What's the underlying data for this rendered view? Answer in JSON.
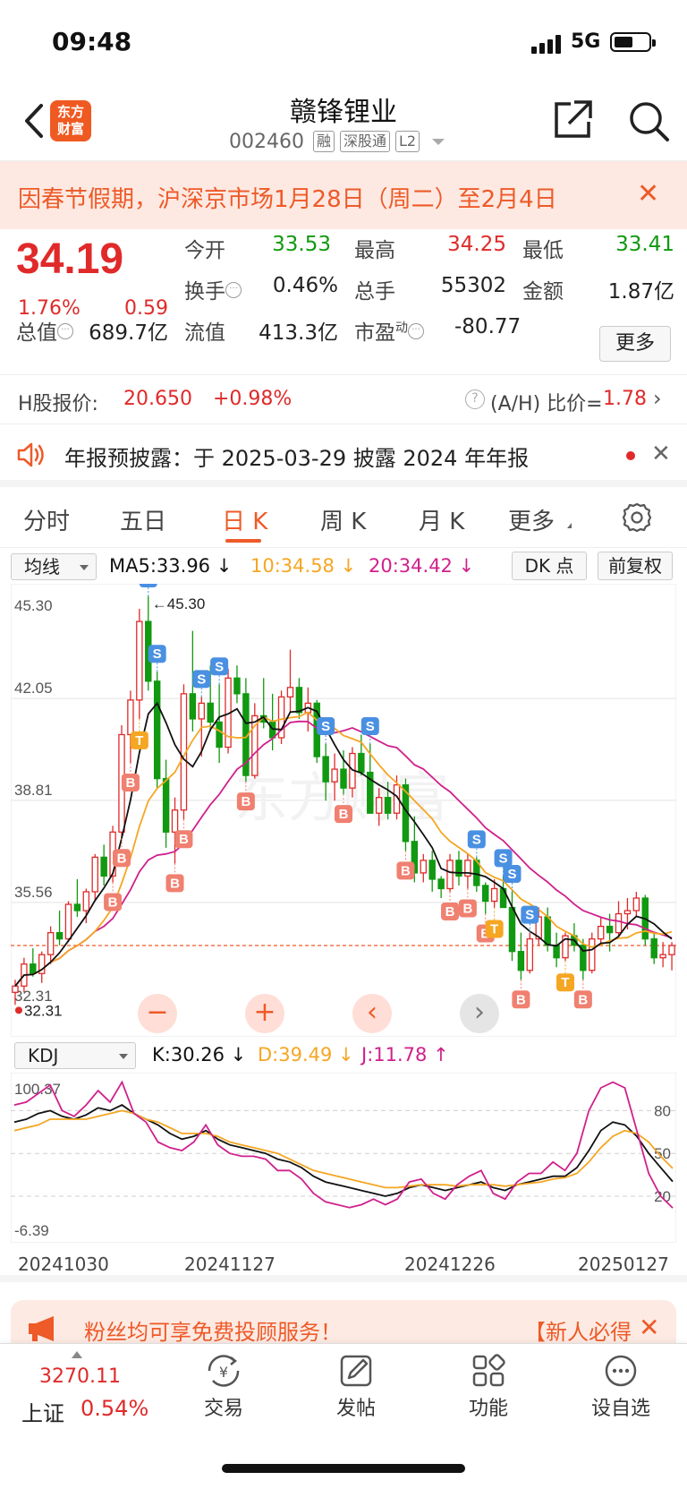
{
  "status_bar": {
    "time": "09:48",
    "network": "5G"
  },
  "header": {
    "back_icon": "chevron-left-icon",
    "logo_text_line1": "东方",
    "logo_text_line2": "财富",
    "title": "赣锋锂业",
    "code": "002460",
    "tags": [
      "融",
      "深股通",
      "L2"
    ],
    "share_icon": "share-icon",
    "search_icon": "search-icon"
  },
  "notice": {
    "text": "因春节假期，沪深京市场1月28日（周二）至2月4日",
    "close": "✕"
  },
  "quote": {
    "price": "34.19",
    "pct_change": "1.76%",
    "change": "0.59",
    "open_label": "今开",
    "open": "33.53",
    "high_label": "最高",
    "high": "34.25",
    "low_label": "最低",
    "low": "33.41",
    "turnover_label": "换手",
    "turnover": "0.46%",
    "volume_label": "总手",
    "volume": "55302",
    "amount_label": "金额",
    "amount": "1.87亿",
    "mktcap_label": "总值",
    "mktcap": "689.7亿",
    "float_label": "流值",
    "float": "413.3亿",
    "pe_label": "市盈",
    "pe_sup": "动",
    "pe": "-80.77",
    "more_label": "更多"
  },
  "h_share": {
    "label": "H股报价:",
    "price": "20.650",
    "change": "+0.98%",
    "ratio_label": "(A/H) 比价=",
    "ratio": "1.78"
  },
  "announcement": {
    "text": "年报预披露：于 2025-03-29 披露 2024 年年报",
    "close": "✕"
  },
  "tabs": [
    {
      "label": "分时"
    },
    {
      "label": "五日"
    },
    {
      "label": "日 K",
      "active": true
    },
    {
      "label": "周 K"
    },
    {
      "label": "月 K"
    },
    {
      "label": "更多"
    }
  ],
  "ma_bar": {
    "selector": "均线",
    "ma5": "MA5:33.96 ↓",
    "ma10": "10:34.58 ↓",
    "ma20": "20:34.42 ↓",
    "dk_label": "DK 点",
    "adjust_label": "前复权",
    "colors": {
      "ma5": "#111111",
      "ma10": "#f5a623",
      "ma20": "#d0208c",
      "up": "#e02a2a",
      "down": "#119911"
    }
  },
  "chart_data": [
    {
      "type": "candlestick",
      "y_ticks": [
        "45.30",
        "42.05",
        "38.81",
        "35.56",
        "32.31"
      ],
      "ylim": [
        32.31,
        45.3
      ],
      "high_marker": "←45.30",
      "low_marker": "32.31",
      "last_close": 34.19,
      "candles": [
        [
          32.7,
          33.1,
          32.3,
          32.9
        ],
        [
          32.9,
          33.8,
          32.7,
          33.6
        ],
        [
          33.6,
          34.1,
          33.2,
          33.3
        ],
        [
          33.3,
          34.0,
          33.0,
          33.9
        ],
        [
          33.9,
          34.8,
          33.6,
          34.6
        ],
        [
          34.6,
          35.3,
          34.2,
          34.4
        ],
        [
          34.4,
          35.6,
          34.3,
          35.5
        ],
        [
          35.5,
          36.3,
          35.1,
          35.3
        ],
        [
          35.3,
          36.0,
          34.9,
          35.9
        ],
        [
          35.9,
          37.1,
          35.6,
          37.0
        ],
        [
          37.0,
          37.4,
          36.1,
          36.4
        ],
        [
          36.4,
          38.0,
          36.2,
          37.8
        ],
        [
          37.8,
          41.2,
          37.6,
          40.9
        ],
        [
          40.9,
          42.3,
          40.0,
          42.0
        ],
        [
          42.0,
          44.9,
          41.4,
          44.5
        ],
        [
          44.5,
          45.3,
          42.3,
          42.6
        ],
        [
          42.6,
          42.9,
          39.2,
          39.5
        ],
        [
          39.5,
          40.1,
          37.3,
          37.8
        ],
        [
          37.8,
          38.9,
          36.8,
          38.5
        ],
        [
          38.5,
          42.5,
          38.2,
          42.2
        ],
        [
          42.2,
          44.2,
          41.0,
          41.4
        ],
        [
          41.4,
          42.1,
          40.2,
          41.9
        ],
        [
          41.9,
          43.1,
          41.0,
          41.3
        ],
        [
          41.3,
          42.5,
          40.0,
          40.5
        ],
        [
          40.5,
          43.0,
          40.3,
          42.7
        ],
        [
          42.7,
          43.1,
          41.9,
          42.2
        ],
        [
          42.2,
          42.7,
          39.4,
          39.6
        ],
        [
          39.6,
          41.9,
          39.5,
          41.5
        ],
        [
          41.5,
          42.7,
          41.1,
          41.3
        ],
        [
          41.3,
          42.2,
          40.4,
          40.8
        ],
        [
          40.8,
          42.3,
          40.6,
          42.1
        ],
        [
          42.1,
          43.6,
          41.6,
          42.4
        ],
        [
          42.4,
          42.7,
          41.4,
          41.6
        ],
        [
          41.6,
          42.4,
          41.0,
          41.9
        ],
        [
          41.9,
          42.0,
          40.0,
          40.2
        ],
        [
          40.2,
          40.6,
          38.8,
          39.4
        ],
        [
          39.4,
          40.3,
          38.8,
          39.8
        ],
        [
          39.8,
          40.4,
          39.0,
          39.2
        ],
        [
          39.2,
          40.5,
          38.9,
          40.3
        ],
        [
          40.3,
          40.9,
          39.6,
          39.7
        ],
        [
          39.7,
          40.6,
          39.5,
          38.4
        ],
        [
          38.4,
          39.2,
          38.0,
          38.9
        ],
        [
          38.9,
          39.4,
          38.2,
          38.4
        ],
        [
          38.4,
          39.6,
          38.2,
          39.3
        ],
        [
          39.3,
          39.5,
          37.2,
          37.5
        ],
        [
          37.5,
          38.3,
          36.2,
          36.5
        ],
        [
          36.5,
          37.1,
          36.2,
          36.9
        ],
        [
          36.9,
          37.2,
          35.9,
          36.3
        ],
        [
          36.3,
          36.4,
          35.7,
          36.0
        ],
        [
          36.0,
          37.1,
          35.9,
          36.9
        ],
        [
          36.9,
          37.2,
          36.1,
          36.4
        ],
        [
          36.4,
          37.1,
          36.0,
          36.9
        ],
        [
          36.9,
          37.0,
          35.9,
          36.1
        ],
        [
          36.1,
          36.2,
          35.2,
          35.6
        ],
        [
          35.6,
          36.3,
          35.4,
          36.0
        ],
        [
          36.0,
          36.4,
          35.5,
          35.4
        ],
        [
          35.4,
          35.9,
          33.7,
          34.0
        ],
        [
          34.0,
          34.6,
          33.1,
          33.4
        ],
        [
          33.4,
          34.6,
          33.3,
          34.4
        ],
        [
          34.4,
          35.4,
          34.2,
          35.1
        ],
        [
          35.1,
          35.4,
          34.0,
          34.2
        ],
        [
          34.2,
          34.6,
          33.5,
          33.8
        ],
        [
          33.8,
          34.6,
          33.7,
          34.5
        ],
        [
          34.5,
          34.9,
          34.0,
          34.2
        ],
        [
          34.2,
          34.4,
          33.1,
          33.4
        ],
        [
          33.4,
          34.6,
          33.3,
          34.4
        ],
        [
          34.4,
          35.1,
          34.2,
          34.8
        ],
        [
          34.8,
          35.2,
          34.0,
          34.6
        ],
        [
          34.6,
          35.6,
          34.5,
          35.2
        ],
        [
          35.2,
          35.7,
          34.7,
          35.3
        ],
        [
          35.3,
          35.9,
          35.1,
          35.7
        ],
        [
          35.7,
          35.8,
          34.2,
          34.4
        ],
        [
          34.4,
          34.6,
          33.6,
          33.8
        ],
        [
          33.8,
          34.3,
          33.5,
          33.9
        ],
        [
          33.9,
          34.3,
          33.4,
          34.19
        ]
      ],
      "signals": [
        {
          "i": 11,
          "label": "B"
        },
        {
          "i": 12,
          "label": "B"
        },
        {
          "i": 13,
          "label": "B"
        },
        {
          "i": 14,
          "label": "T"
        },
        {
          "i": 15,
          "label": "S"
        },
        {
          "i": 16,
          "label": "S"
        },
        {
          "i": 18,
          "label": "B"
        },
        {
          "i": 19,
          "label": "B"
        },
        {
          "i": 21,
          "label": "S"
        },
        {
          "i": 23,
          "label": "S"
        },
        {
          "i": 26,
          "label": "B"
        },
        {
          "i": 35,
          "label": "S"
        },
        {
          "i": 37,
          "label": "B"
        },
        {
          "i": 40,
          "label": "S"
        },
        {
          "i": 44,
          "label": "B"
        },
        {
          "i": 49,
          "label": "B"
        },
        {
          "i": 51,
          "label": "B"
        },
        {
          "i": 52,
          "label": "S"
        },
        {
          "i": 53,
          "label": "B"
        },
        {
          "i": 54,
          "label": "T"
        },
        {
          "i": 55,
          "label": "S"
        },
        {
          "i": 56,
          "label": "S"
        },
        {
          "i": 57,
          "label": "B"
        },
        {
          "i": 58,
          "label": "S"
        },
        {
          "i": 62,
          "label": "T"
        },
        {
          "i": 64,
          "label": "B"
        }
      ]
    },
    {
      "type": "line",
      "y_ticks": [
        "100.37",
        "-6.39"
      ],
      "ref_lines": [
        "80",
        "50",
        "20"
      ],
      "series": [
        {
          "name": "K",
          "values": [
            72,
            74,
            78,
            80,
            76,
            74,
            77,
            82,
            80,
            84,
            78,
            74,
            70,
            64,
            60,
            62,
            66,
            60,
            56,
            54,
            52,
            50,
            46,
            44,
            40,
            34,
            30,
            28,
            26,
            24,
            22,
            20,
            22,
            26,
            28,
            26,
            24,
            26,
            28,
            30,
            26,
            24,
            28,
            30,
            32,
            34,
            34,
            40,
            52,
            66,
            72,
            70,
            62,
            50,
            40,
            30.26
          ]
        },
        {
          "name": "D",
          "values": [
            66,
            68,
            70,
            74,
            74,
            74,
            74,
            76,
            78,
            80,
            78,
            74,
            72,
            68,
            64,
            64,
            64,
            62,
            58,
            56,
            54,
            52,
            50,
            46,
            42,
            38,
            36,
            34,
            32,
            30,
            28,
            26,
            26,
            27,
            28,
            28,
            28,
            27,
            28,
            28,
            28,
            27,
            28,
            29,
            30,
            32,
            33,
            36,
            44,
            54,
            62,
            66,
            64,
            58,
            48,
            39.49
          ]
        },
        {
          "name": "J",
          "values": [
            84,
            86,
            92,
            98,
            80,
            76,
            84,
            94,
            86,
            100,
            78,
            72,
            58,
            54,
            52,
            58,
            70,
            56,
            50,
            48,
            48,
            46,
            38,
            38,
            32,
            22,
            16,
            14,
            12,
            14,
            18,
            14,
            18,
            30,
            32,
            22,
            18,
            28,
            34,
            38,
            22,
            18,
            30,
            36,
            36,
            44,
            38,
            50,
            80,
            96,
            100,
            96,
            66,
            36,
            20,
            11.78
          ]
        }
      ]
    }
  ],
  "kdj_bar": {
    "selector": "KDJ",
    "k": "K:30.26 ↓",
    "d": "D:39.49 ↓",
    "j": "J:11.78 ↑"
  },
  "date_axis": [
    "20241030",
    "20241127",
    "20241226",
    "20250127"
  ],
  "chart_controls": {
    "zoom_out": "−",
    "zoom_in": "+",
    "prev": "‹",
    "next": "›"
  },
  "promo": {
    "text": "粉丝均可享免费投顾服务！",
    "right": "【新人必得",
    "close": "✕"
  },
  "bottom_nav": {
    "index_value": "3270.11",
    "index_name": "上证",
    "index_change": "0.54%",
    "items": [
      {
        "label": "交易",
        "icon": "yuan-exchange-icon"
      },
      {
        "label": "发帖",
        "icon": "edit-icon"
      },
      {
        "label": "功能",
        "icon": "grid-icon"
      },
      {
        "label": "设自选",
        "icon": "more-dots-icon"
      }
    ]
  }
}
